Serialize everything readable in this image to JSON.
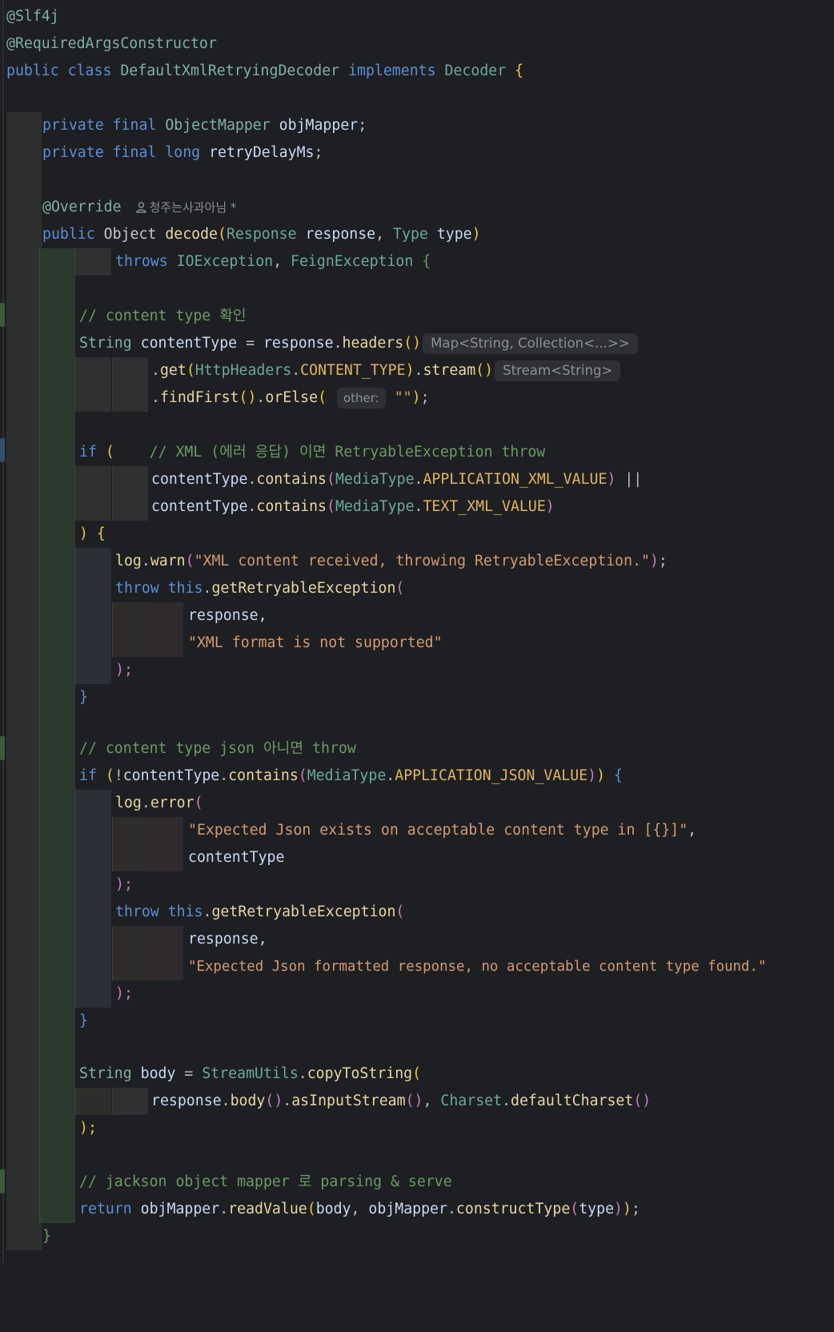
{
  "code": {
    "l1_ann1": "@Slf4j",
    "l2_ann2": "@RequiredArgsConstructor",
    "l3": {
      "kw_public": "public",
      "kw_class": "class",
      "class_name": "DefaultXmlRetryingDecoder",
      "kw_implements": "implements",
      "iface": "Decoder",
      "brace": "{"
    },
    "l5": {
      "kw": "private final",
      "type": "ObjectMapper",
      "name": "objMapper",
      "end": ";"
    },
    "l6": {
      "kw1": "private final",
      "kw2": "long",
      "name": "retryDelayMs",
      "end": ";"
    },
    "l8": {
      "ann": "@Override",
      "author": "청주는사과아님 *"
    },
    "l9": {
      "kw": "public",
      "ret": "Object",
      "fn": "decode",
      "p1type": "Response",
      "p1": "response",
      "p2type": "Type",
      "p2": "type"
    },
    "l10": {
      "kw": "throws",
      "e1": "IOException",
      "e2": "FeignException",
      "brace": "{"
    },
    "l12_cmt": "// content type 확인",
    "l13": {
      "type": "String",
      "name": "contentType",
      "eq": "=",
      "obj": "response",
      "fn": "headers",
      "hint": "Map<String, Collection<...>>"
    },
    "l14": {
      "fn": "get",
      "cls": "HttpHeaders",
      "const": "CONTENT_TYPE",
      "fn2": "stream",
      "hint": "Stream<String>"
    },
    "l15": {
      "fn1": "findFirst",
      "fn2": "orElse",
      "hint": "other:",
      "str": "\"\""
    },
    "l17": {
      "kw": "if",
      "cmt": "// XML (에러 응답) 이면 RetryableException throw"
    },
    "l18": {
      "var": "contentType",
      "fn": "contains",
      "cls": "MediaType",
      "const": "APPLICATION_XML_VALUE",
      "op": "||"
    },
    "l19": {
      "var": "contentType",
      "fn": "contains",
      "cls": "MediaType",
      "const": "TEXT_XML_VALUE"
    },
    "l20": ") {",
    "l21": {
      "obj": "log",
      "fn": "warn",
      "str": "\"XML content received, throwing RetryableException.\""
    },
    "l22": {
      "kw1": "throw",
      "kw2": "this",
      "fn": "getRetryableException"
    },
    "l23": "response,",
    "l24": "\"XML format is not supported\"",
    "l25": ");",
    "l26": "}",
    "l28_cmt": "// content type json 아니면 throw",
    "l29": {
      "kw": "if",
      "var": "contentType",
      "fn": "contains",
      "cls": "MediaType",
      "const": "APPLICATION_JSON_VALUE"
    },
    "l30": {
      "obj": "log",
      "fn": "error"
    },
    "l31": "\"Expected Json exists on acceptable content type in [{}]\"",
    "l32": "contentType",
    "l33": ");",
    "l34": {
      "kw1": "throw",
      "kw2": "this",
      "fn": "getRetryableException"
    },
    "l35": "response,",
    "l36": "\"Expected Json formatted response, no acceptable content type found.\"",
    "l37": ");",
    "l38": "}",
    "l40": {
      "type": "String",
      "name": "body",
      "cls": "StreamUtils",
      "fn": "copyToString"
    },
    "l41": {
      "obj": "response",
      "fn1": "body",
      "fn2": "asInputStream",
      "cls": "Charset",
      "fn3": "defaultCharset"
    },
    "l42": ");",
    "l44_cmt": "// jackson object mapper 로 parsing & serve",
    "l45": {
      "kw": "return",
      "obj": "objMapper",
      "fn": "readValue",
      "arg": "body",
      "fn2": "constructType",
      "arg2": "type"
    },
    "l46": "}"
  }
}
